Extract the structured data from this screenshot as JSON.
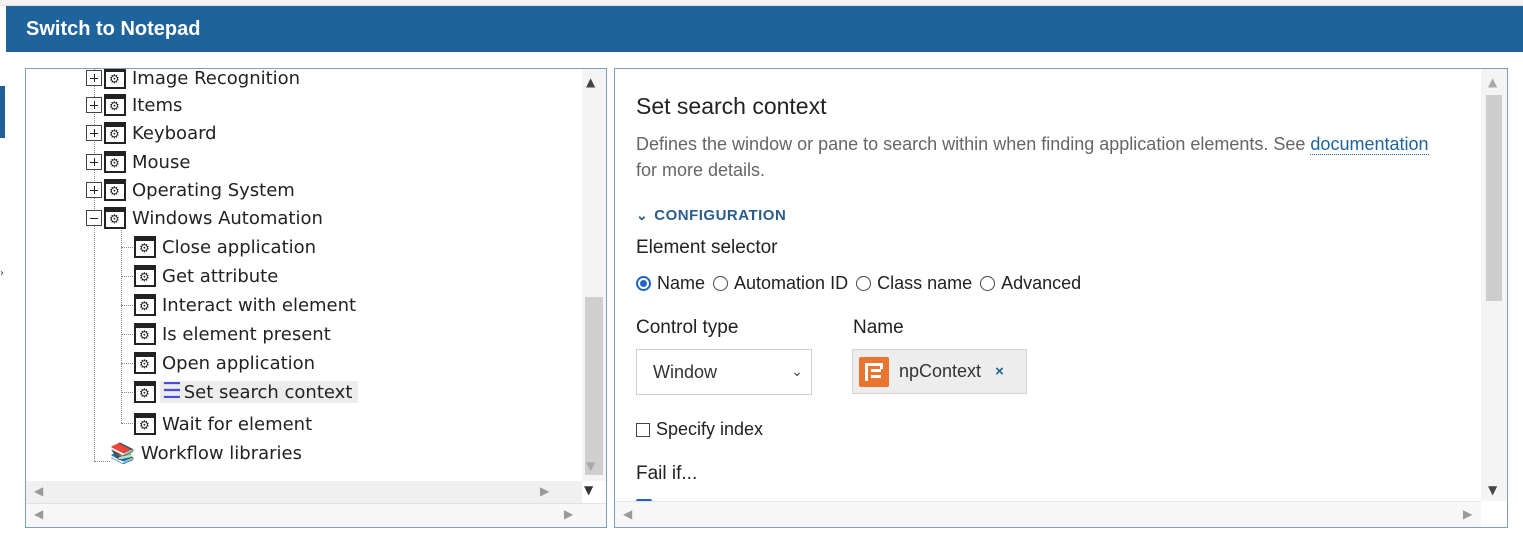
{
  "window": {
    "title": "Switch to Notepad"
  },
  "tree": {
    "categories": [
      {
        "label": "Image Recognition",
        "expanded": false
      },
      {
        "label": "Items",
        "expanded": false
      },
      {
        "label": "Keyboard",
        "expanded": false
      },
      {
        "label": "Mouse",
        "expanded": false
      },
      {
        "label": "Operating System",
        "expanded": false
      },
      {
        "label": "Windows Automation",
        "expanded": true
      }
    ],
    "actions": [
      {
        "label": "Close application"
      },
      {
        "label": "Get attribute"
      },
      {
        "label": "Interact with element"
      },
      {
        "label": "Is element present"
      },
      {
        "label": "Open application"
      },
      {
        "label": "Set search context",
        "selected": true
      },
      {
        "label": "Wait for element"
      }
    ],
    "libraries": {
      "label": "Workflow libraries"
    }
  },
  "details": {
    "title": "Set search context",
    "description_prefix": "Defines the window or pane to search within when finding application elements. See",
    "description_link": "documentation",
    "description_suffix": "for more details.",
    "section_header": "CONFIGURATION",
    "element_selector": {
      "label": "Element selector",
      "options": [
        {
          "label": "Name",
          "checked": true
        },
        {
          "label": "Automation ID",
          "checked": false
        },
        {
          "label": "Class name",
          "checked": false
        },
        {
          "label": "Advanced",
          "checked": false
        }
      ]
    },
    "control_type": {
      "label": "Control type",
      "value": "Window"
    },
    "name_field": {
      "label": "Name",
      "chip_value": "npContext",
      "remove_glyph": "×"
    },
    "specify_index": {
      "label": "Specify index",
      "checked": false
    },
    "fail_if": {
      "label": "Fail if..."
    }
  },
  "icons": {
    "tree_node": "gear-window-icon",
    "selected_node": "checklist-icon",
    "libraries": "books-icon",
    "chip": "variable-icon",
    "accent_color": "#1f639c",
    "chip_color": "#e8742e"
  }
}
